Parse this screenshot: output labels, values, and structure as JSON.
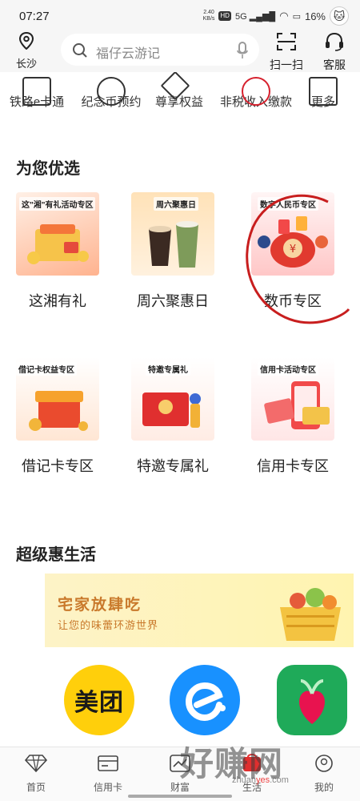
{
  "status_bar": {
    "time": "07:27",
    "net_speed_top": "2.40",
    "net_speed_unit": "KB/s",
    "hd": "HD",
    "signal": "5G",
    "battery": "16%"
  },
  "top_bar": {
    "location": "长沙",
    "search_placeholder": "福仔云游记",
    "scan_label": "扫一扫",
    "service_label": "客服"
  },
  "quick_menu": [
    {
      "label": "铁路e卡通",
      "icon": "rail-card-icon"
    },
    {
      "label": "纪念币预约",
      "icon": "coin-icon"
    },
    {
      "label": "尊享权益",
      "icon": "diamond-icon"
    },
    {
      "label": "非税收入缴款",
      "icon": "tax-icon"
    },
    {
      "label": "更多",
      "icon": "grid-icon"
    }
  ],
  "section_preferred": {
    "title": "为您优选",
    "items": [
      {
        "label": "这湘有礼",
        "tag": "这\"湘\"有礼活动专区",
        "color": "#ffd9c2"
      },
      {
        "label": "周六聚惠日",
        "tag": "周六聚惠日",
        "color": "#ffe6c4"
      },
      {
        "label": "数币专区",
        "tag": "数字人民币专区",
        "color": "#ffd0d0"
      },
      {
        "label": "借记卡专区",
        "tag": "借记卡权益专区",
        "color": "#ffe3d2"
      },
      {
        "label": "特邀专属礼",
        "tag": "特邀专属礼",
        "color": "#ffe9e0"
      },
      {
        "label": "信用卡专区",
        "tag": "信用卡活动专区",
        "color": "#ffe4e4"
      }
    ]
  },
  "section_life": {
    "title": "超级惠生活",
    "banner_title": "宅家放肆吃",
    "banner_sub": "让您的味蕾环游世界",
    "apps": [
      {
        "name": "美团"
      },
      {
        "name": "eleme"
      },
      {
        "name": "green-app"
      }
    ]
  },
  "tab_bar": [
    {
      "label": "首页",
      "icon": "diamond-icon"
    },
    {
      "label": "信用卡",
      "icon": "card-icon"
    },
    {
      "label": "财富",
      "icon": "trend-icon"
    },
    {
      "label": "生活",
      "icon": "life-icon"
    },
    {
      "label": "我的",
      "icon": "user-icon"
    }
  ],
  "watermark": {
    "main": "好赚网",
    "sub_a": "zhuan",
    "sub_b": "yes",
    "sub_c": ".com"
  },
  "colors": {
    "accent_red": "#d6202d",
    "banner_text": "#c9792b"
  }
}
